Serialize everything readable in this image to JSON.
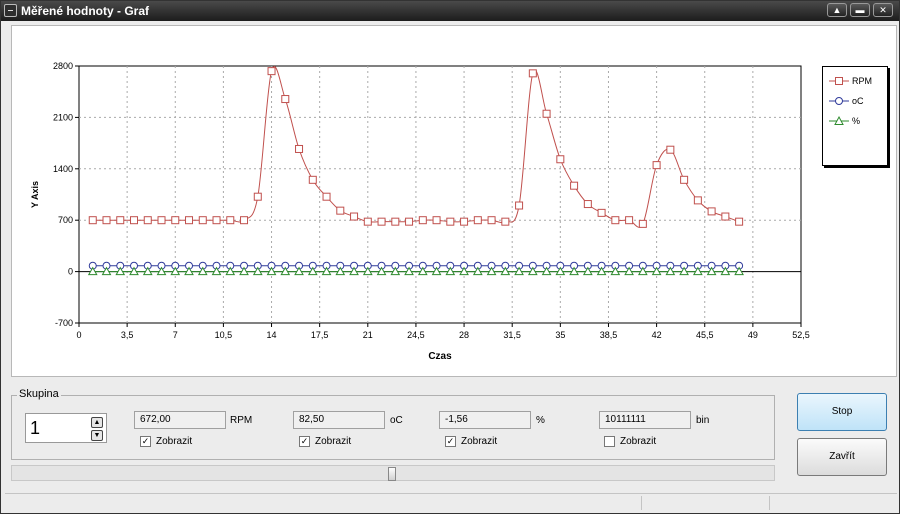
{
  "window": {
    "title": "Měřené hodnoty - Graf",
    "controls": {
      "minimize": "▲",
      "maximize": "▬",
      "close": "✕"
    }
  },
  "legend": {
    "items": [
      {
        "label": "RPM",
        "color": "#c0504d",
        "marker": "square"
      },
      {
        "label": "oC",
        "color": "#2f3a9a",
        "marker": "circle"
      },
      {
        "label": "%",
        "color": "#2e8b2e",
        "marker": "triangle"
      }
    ]
  },
  "chart_data": {
    "type": "line",
    "xlabel": "Czas",
    "ylabel": "Y Axis",
    "xlim": [
      0,
      52.5
    ],
    "ylim": [
      -700,
      2800
    ],
    "xticks": [
      0,
      3.5,
      7,
      10.5,
      14,
      17.5,
      21,
      24.5,
      28,
      31.5,
      35,
      38.5,
      42,
      45.5,
      49,
      52.5
    ],
    "xtick_labels": [
      "0",
      "3,5",
      "7",
      "10,5",
      "14",
      "17,5",
      "21",
      "24,5",
      "28",
      "31,5",
      "35",
      "38,5",
      "42",
      "45,5",
      "49",
      "52,5"
    ],
    "yticks": [
      -700,
      0,
      700,
      1400,
      2100,
      2800
    ],
    "grid": true,
    "legend_position": "right",
    "x": [
      1,
      2,
      3,
      4,
      5,
      6,
      7,
      8,
      9,
      10,
      11,
      12,
      13,
      14,
      15,
      16,
      17,
      18,
      19,
      20,
      21,
      22,
      23,
      24,
      25,
      26,
      27,
      28,
      29,
      30,
      31,
      32,
      33,
      34,
      35,
      36,
      37,
      38,
      39,
      40,
      41,
      42,
      43,
      44,
      45,
      46,
      47,
      48
    ],
    "series": [
      {
        "name": "RPM",
        "color": "#c0504d",
        "values": [
          700,
          700,
          700,
          700,
          700,
          700,
          700,
          700,
          700,
          700,
          700,
          700,
          1020,
          2730,
          2350,
          1670,
          1250,
          1020,
          830,
          750,
          680,
          680,
          680,
          680,
          700,
          700,
          680,
          680,
          700,
          700,
          680,
          900,
          2700,
          2150,
          1530,
          1170,
          920,
          800,
          700,
          700,
          650,
          1450,
          1660,
          1250,
          970,
          820,
          750,
          680
        ]
      },
      {
        "name": "oC",
        "color": "#2f3a9a",
        "values": [
          80,
          80,
          80,
          80,
          80,
          80,
          80,
          80,
          80,
          80,
          80,
          80,
          80,
          80,
          80,
          80,
          80,
          80,
          80,
          80,
          80,
          80,
          80,
          80,
          80,
          80,
          80,
          80,
          80,
          80,
          80,
          80,
          80,
          80,
          80,
          80,
          80,
          80,
          80,
          80,
          80,
          80,
          80,
          80,
          80,
          80,
          80,
          80
        ]
      },
      {
        "name": "%",
        "color": "#2e8b2e",
        "values": [
          0,
          0,
          0,
          0,
          0,
          0,
          0,
          0,
          0,
          0,
          0,
          0,
          0,
          0,
          0,
          0,
          0,
          0,
          0,
          0,
          0,
          0,
          0,
          0,
          0,
          0,
          0,
          0,
          0,
          0,
          0,
          0,
          0,
          0,
          0,
          0,
          0,
          0,
          0,
          0,
          0,
          0,
          0,
          0,
          0,
          0,
          0,
          0
        ]
      }
    ]
  },
  "group": {
    "label": "Skupina",
    "spinner_value": "1",
    "channels": [
      {
        "value": "672,00",
        "unit": "RPM",
        "checkbox_label": "Zobrazit",
        "checked": true
      },
      {
        "value": "82,50",
        "unit": "oC",
        "checkbox_label": "Zobrazit",
        "checked": true
      },
      {
        "value": "-1,56",
        "unit": "%",
        "checkbox_label": "Zobrazit",
        "checked": true
      },
      {
        "value": "10111111",
        "unit": "bin",
        "checkbox_label": "Zobrazit",
        "checked": false
      }
    ]
  },
  "buttons": {
    "stop": "Stop",
    "close": "Zavřít"
  },
  "slider": {
    "position": 0.5
  }
}
